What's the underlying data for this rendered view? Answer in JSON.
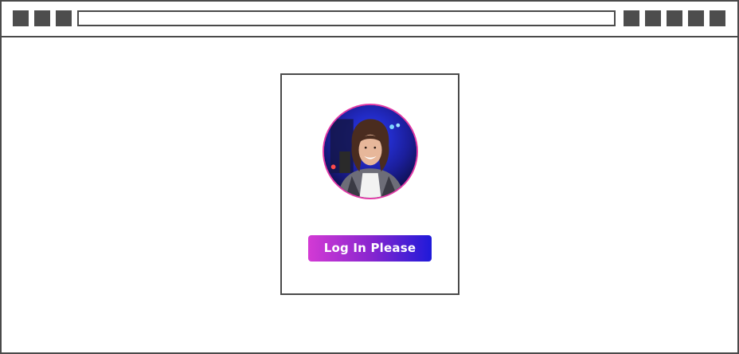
{
  "window": {
    "left_controls": [
      "window-control-1",
      "window-control-2",
      "window-control-3"
    ],
    "right_controls": [
      "toolbar-button-1",
      "toolbar-button-2",
      "toolbar-button-3",
      "toolbar-button-4",
      "toolbar-button-5"
    ],
    "address_bar": {
      "value": ""
    }
  },
  "login_card": {
    "avatar": {
      "description_icon": "user-avatar-photo",
      "border_color": "#e23aa6"
    },
    "button_label": "Log In Please",
    "button_gradient": [
      "#d33ad4",
      "#1f1ad9"
    ]
  }
}
